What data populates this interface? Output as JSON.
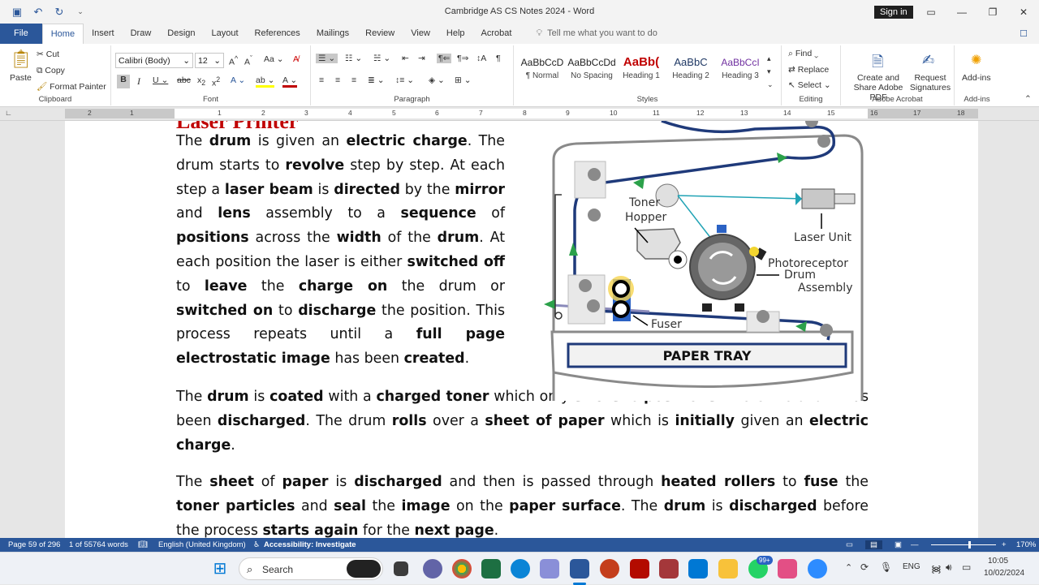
{
  "window": {
    "title": "Cambridge AS CS Notes 2024  -  Word",
    "sign_in": "Sign in"
  },
  "tabs": [
    "File",
    "Home",
    "Insert",
    "Draw",
    "Design",
    "Layout",
    "References",
    "Mailings",
    "Review",
    "View",
    "Help",
    "Acrobat"
  ],
  "tell_me": "Tell me what you want to do",
  "ribbon": {
    "clipboard": {
      "label": "Clipboard",
      "paste": "Paste",
      "cut": "Cut",
      "copy": "Copy",
      "format_painter": "Format Painter"
    },
    "font": {
      "label": "Font",
      "family": "Calibri (Body)",
      "size": "12"
    },
    "paragraph": {
      "label": "Paragraph"
    },
    "styles": {
      "label": "Styles",
      "items": [
        {
          "preview": "AaBbCcD",
          "name": "¶ Normal"
        },
        {
          "preview": "AaBbCcDd",
          "name": "No Spacing"
        },
        {
          "preview": "AaBb(",
          "name": "Heading 1"
        },
        {
          "preview": "AaBbC",
          "name": "Heading 2"
        },
        {
          "preview": "AaBbCcI",
          "name": "Heading 3"
        }
      ]
    },
    "editing": {
      "label": "Editing",
      "find": "Find",
      "replace": "Replace",
      "select": "Select"
    },
    "acrobat": {
      "label": "Adobe Acrobat",
      "create": "Create and Share Adobe PDF",
      "request": "Request Signatures"
    },
    "addins": {
      "label": "Add-ins",
      "button": "Add-ins"
    }
  },
  "ruler_numbers": [
    "2",
    "1",
    "1",
    "2",
    "3",
    "4",
    "5",
    "6",
    "7",
    "8",
    "9",
    "10",
    "11",
    "12",
    "13",
    "14",
    "15",
    "16",
    "17",
    "18"
  ],
  "document": {
    "heading_fragment": "Laser Printer",
    "p1": [
      [
        "The ",
        0
      ],
      [
        "drum",
        1
      ],
      [
        " is given an ",
        0
      ],
      [
        "electric charge",
        1
      ],
      [
        ". The drum starts to ",
        0
      ],
      [
        "revolve",
        1
      ],
      [
        " step by step. At each step a ",
        0
      ],
      [
        "laser beam",
        1
      ],
      [
        " is ",
        0
      ],
      [
        "directed",
        1
      ],
      [
        " by the ",
        0
      ],
      [
        "mirror",
        1
      ],
      [
        " and ",
        0
      ],
      [
        "lens",
        1
      ],
      [
        " assembly to a ",
        0
      ],
      [
        "sequence",
        1
      ],
      [
        " of ",
        0
      ],
      [
        "positions",
        1
      ],
      [
        " across the ",
        0
      ],
      [
        "width",
        1
      ],
      [
        " of the ",
        0
      ],
      [
        "drum",
        1
      ],
      [
        ". At each position the laser is either ",
        0
      ],
      [
        "switched off",
        1
      ],
      [
        " to ",
        0
      ],
      [
        "leave",
        1
      ],
      [
        " the ",
        0
      ],
      [
        "charge on",
        1
      ],
      [
        " the drum or ",
        0
      ],
      [
        "switched on",
        1
      ],
      [
        " to ",
        0
      ],
      [
        "discharge",
        1
      ],
      [
        " the position. This process repeats until a ",
        0
      ],
      [
        "full page electrostatic image",
        1
      ],
      [
        " has been ",
        0
      ],
      [
        "created",
        1
      ],
      [
        ".",
        0
      ]
    ],
    "p2": [
      [
        "The ",
        0
      ],
      [
        "drum",
        1
      ],
      [
        " is ",
        0
      ],
      [
        "coated",
        1
      ],
      [
        " with a ",
        0
      ],
      [
        "charged toner",
        1
      ],
      [
        " which only ",
        0
      ],
      [
        "sticks",
        1
      ],
      [
        " to ",
        0
      ],
      [
        "positions",
        1
      ],
      [
        " where the ",
        0
      ],
      [
        "drum",
        1
      ],
      [
        " has been ",
        0
      ],
      [
        "discharged",
        1
      ],
      [
        ". The drum ",
        0
      ],
      [
        "rolls",
        1
      ],
      [
        " over a ",
        0
      ],
      [
        "sheet of paper",
        1
      ],
      [
        " which is ",
        0
      ],
      [
        "initially",
        1
      ],
      [
        " given an ",
        0
      ],
      [
        "electric charge",
        1
      ],
      [
        ".",
        0
      ]
    ],
    "p3": [
      [
        "The ",
        0
      ],
      [
        "sheet",
        1
      ],
      [
        " of ",
        0
      ],
      [
        "paper",
        1
      ],
      [
        " is ",
        0
      ],
      [
        "discharged",
        1
      ],
      [
        " and then is passed through ",
        0
      ],
      [
        "heated rollers",
        1
      ],
      [
        " to ",
        0
      ],
      [
        "fuse",
        1
      ],
      [
        " the ",
        0
      ],
      [
        "toner particles",
        1
      ],
      [
        " and ",
        0
      ],
      [
        "seal",
        1
      ],
      [
        " the ",
        0
      ],
      [
        "image",
        1
      ],
      [
        " on the ",
        0
      ],
      [
        "paper surface",
        1
      ],
      [
        ". The ",
        0
      ],
      [
        "drum",
        1
      ],
      [
        " is ",
        0
      ],
      [
        "discharged",
        1
      ],
      [
        " before the process ",
        0
      ],
      [
        "starts again",
        1
      ],
      [
        " for the ",
        0
      ],
      [
        "next page",
        1
      ],
      [
        ".",
        0
      ]
    ]
  },
  "diagram": {
    "toner_hopper": "Toner\nHopper",
    "laser_unit": "Laser Unit",
    "drum_assembly": "Photoreceptor\nDrum\nAssembly",
    "fuser": "Fuser",
    "paper_tray": "PAPER TRAY"
  },
  "status": {
    "page": "Page 59 of 296",
    "words": "1 of 55764 words",
    "language": "English (United Kingdom)",
    "accessibility": "Accessibility: Investigate",
    "zoom": "170%"
  },
  "taskbar": {
    "search": "Search",
    "lang": "ENG",
    "time": "10:05",
    "date": "10/02/2024",
    "badge": "99+"
  }
}
